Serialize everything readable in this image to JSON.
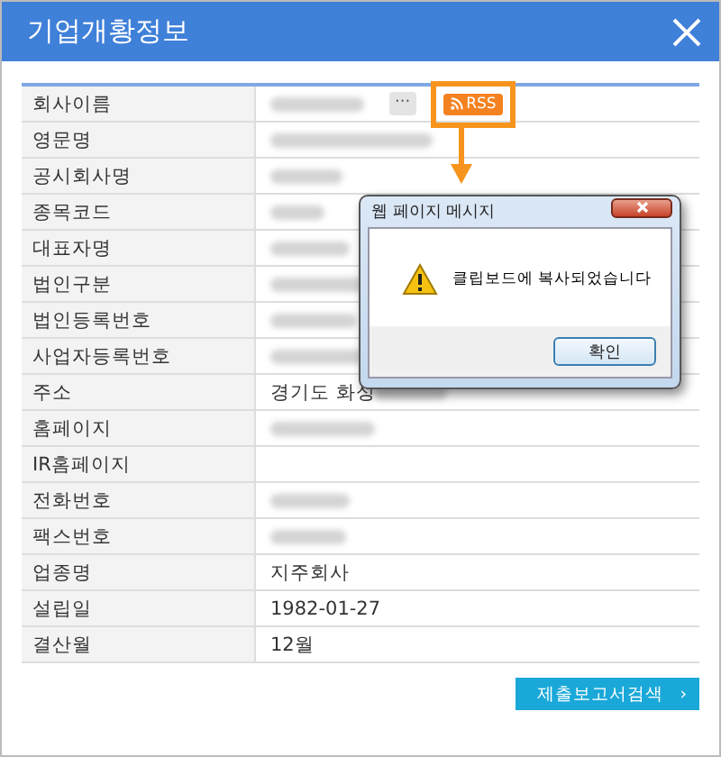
{
  "window": {
    "title": "기업개황정보"
  },
  "rows": [
    {
      "label": "회사이름",
      "redacted": true,
      "more_button": "···",
      "rss_button": "RSS",
      "highlighted": true
    },
    {
      "label": "영문명",
      "redacted": true
    },
    {
      "label": "공시회사명",
      "redacted": true
    },
    {
      "label": "종목코드",
      "redacted": true
    },
    {
      "label": "대표자명",
      "redacted": true
    },
    {
      "label": "법인구분",
      "redacted": true
    },
    {
      "label": "법인등록번호",
      "redacted": true
    },
    {
      "label": "사업자등록번호",
      "redacted": true
    },
    {
      "label": "주소",
      "value": "경기도 화성",
      "redacted": true
    },
    {
      "label": "홈페이지",
      "redacted": true
    },
    {
      "label": "IR홈페이지",
      "redacted": false
    },
    {
      "label": "전화번호",
      "redacted": true
    },
    {
      "label": "팩스번호",
      "redacted": true
    },
    {
      "label": "업종명",
      "value": "지주회사",
      "redacted": false
    },
    {
      "label": "설립일",
      "value": "1982-01-27",
      "redacted": false
    },
    {
      "label": "결산월",
      "value": "12월",
      "redacted": false
    }
  ],
  "search_button": {
    "label": "제출보고서검색",
    "arrow": "›"
  },
  "message_dialog": {
    "title": "웹 페이지 메시지",
    "message": "클립보드에 복사되었습니다",
    "ok_button": "확인"
  }
}
